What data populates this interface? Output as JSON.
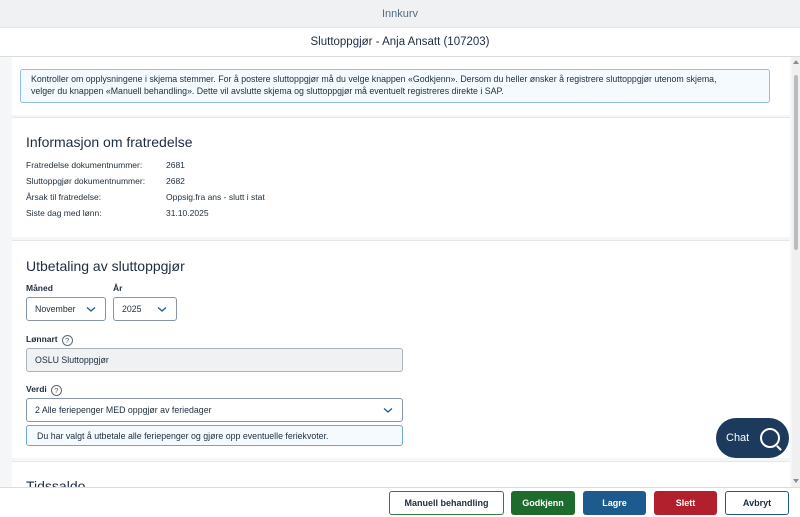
{
  "window": {
    "title": "Innkurv"
  },
  "header": {
    "title": "Sluttoppgjør - Anja Ansatt (107203)"
  },
  "info": {
    "line1": "Kontroller om opplysningene i skjema stemmer. For å postere sluttoppgjør må du velge knappen «Godkjenn». Dersom du heller ønsker å registrere sluttoppgjør utenom skjema,",
    "line2": "velger du knappen «Manuell behandling». Dette vil avslutte skjema og sluttoppgjør må eventuelt registreres direkte i SAP."
  },
  "fratredelse": {
    "title": "Informasjon om fratredelse",
    "rows": [
      {
        "label": "Fratredelse dokumentnummer:",
        "value": "2681"
      },
      {
        "label": "Sluttoppgjør dokumentnummer:",
        "value": "2682"
      },
      {
        "label": "Årsak til fratredelse:",
        "value": "Oppsig.fra ans - slutt i stat"
      },
      {
        "label": "Siste dag med lønn:",
        "value": "31.10.2025"
      }
    ]
  },
  "utbetaling": {
    "title": "Utbetaling av sluttoppgjør",
    "month_label": "Måned",
    "month_value": "November",
    "year_label": "År",
    "year_value": "2025",
    "lonnart_label": "Lønnart",
    "lonnart_value": "OSLU Sluttoppgjør",
    "verdi_label": "Verdi",
    "verdi_value": "2 Alle feriepenger MED oppgjør av feriedager",
    "verdi_hint": "Du har valgt å utbetale alle feriepenger og gjøre opp eventuelle feriekvoter."
  },
  "tidssaldo": {
    "title": "Tidssaldo"
  },
  "chat": {
    "label": "Chat"
  },
  "footer": {
    "manuell": "Manuell behandling",
    "godkjenn": "Godkjenn",
    "lagre": "Lagre",
    "slett": "Slett",
    "avbryt": "Avbryt"
  },
  "colors": {
    "primary_green": "#1e6b2e",
    "primary_blue": "#1d5b8f",
    "danger_red": "#b21f2d",
    "chat_bg": "#1b3a5c"
  },
  "icons": {
    "help": "help-circle-icon",
    "dropdown": "chevron-down-icon",
    "chat": "chat-bubble-icon"
  }
}
